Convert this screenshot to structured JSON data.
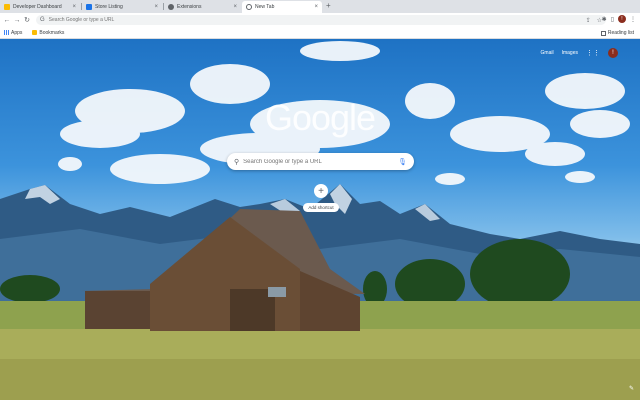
{
  "tabs": [
    {
      "label": "Developer Dashboard",
      "active": false,
      "color": "#fbbc04"
    },
    {
      "label": "Store Listing",
      "active": false,
      "color": "#1a73e8"
    },
    {
      "label": "Extensions",
      "active": false,
      "color": "#5f6368"
    },
    {
      "label": "New Tab",
      "active": true,
      "color": "#5f6368"
    }
  ],
  "toolbar": {
    "omnibox_placeholder": "Search Google or type a URL",
    "profile_initial": "!"
  },
  "bookmarks": {
    "items": [
      {
        "label": "Apps"
      },
      {
        "label": "Bookmarks"
      }
    ],
    "right_label": "Reading list"
  },
  "page": {
    "top_links": {
      "gmail": "Gmail",
      "images": "Images"
    },
    "logo": "Google",
    "search_placeholder": "Search Google or type a URL",
    "shortcut_label": "Add shortcut",
    "profile_initial": "!"
  }
}
